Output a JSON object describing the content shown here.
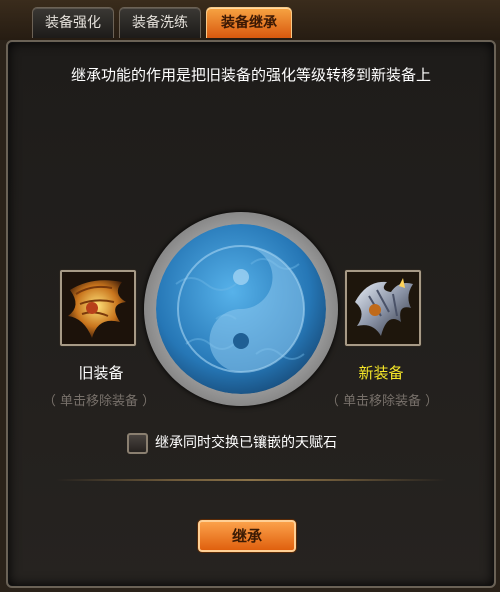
{
  "tabs": [
    {
      "label": "装备强化",
      "active": false
    },
    {
      "label": "装备洗练",
      "active": false
    },
    {
      "label": "装备继承",
      "active": true
    }
  ],
  "description": "继承功能的作用是把旧装备的强化等级转移到新装备上",
  "old_slot": {
    "label": "旧装备",
    "hint": "（ 单击移除装备 ）",
    "label_color": "#ffffff"
  },
  "new_slot": {
    "label": "新装备",
    "hint": "（ 单击移除装备 ）",
    "label_color": "#f5e628"
  },
  "center_emblem": "yin-yang-icon",
  "gem_option": {
    "label": "继承同时交换已镶嵌的天赋石",
    "checked": false
  },
  "inherit_button": {
    "label": "继承"
  },
  "colors": {
    "accent": "#f28a2c",
    "orb_blue": "#2f86c6",
    "panel_bg": "#1f1d1b"
  }
}
